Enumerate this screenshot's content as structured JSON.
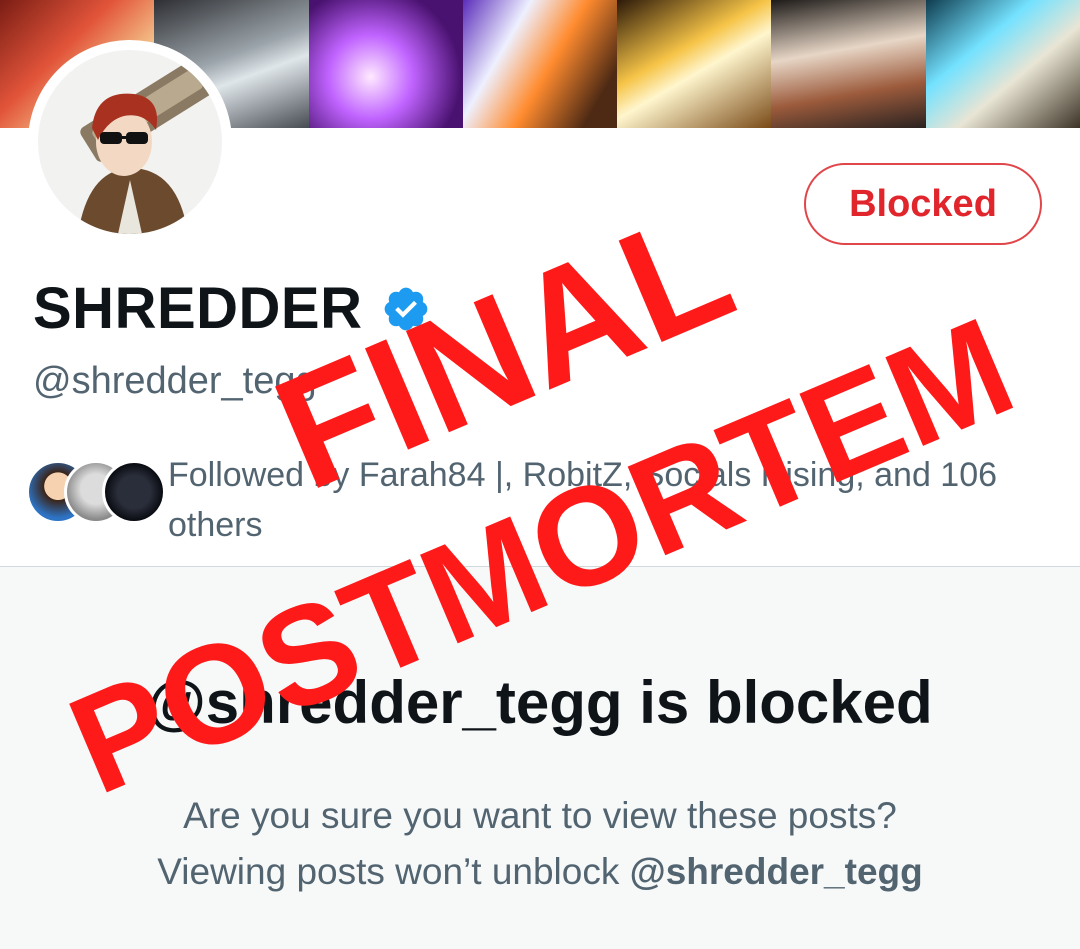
{
  "profile": {
    "display_name": "SHREDDER",
    "handle": "@shredder_tegg",
    "verified_icon": "verified-badge-icon",
    "status_button": "Blocked",
    "followed_by": "Followed by Farah84 |, RobitZ, Socials Rising, and 106 others"
  },
  "blocked_notice": {
    "title": "@shredder_tegg is blocked",
    "line1": "Are you sure you want to view these posts?",
    "line2_prefix": "Viewing posts won’t unblock ",
    "line2_handle": "@shredder_tegg"
  },
  "overlay": {
    "word1": "FINAL",
    "word2": "POSTMORTEM",
    "color": "#ff1a1a"
  },
  "colors": {
    "accent_red": "#e0262c",
    "verified_blue": "#1d9bf0",
    "text_primary": "#0f1419",
    "text_secondary": "#536471"
  }
}
